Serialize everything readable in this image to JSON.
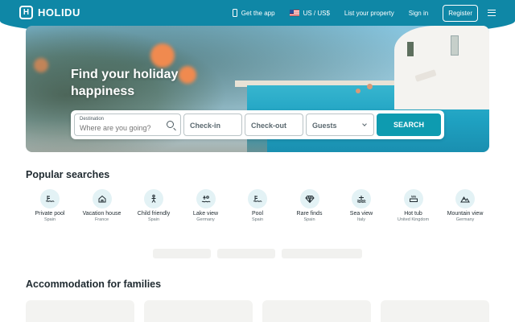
{
  "header": {
    "brand": "HOLIDU",
    "logo_letter": "H",
    "nav": {
      "get_app": "Get the app",
      "currency": "US / US$",
      "list_property": "List your property",
      "sign_in": "Sign in",
      "register": "Register"
    },
    "accent_color": "#0f87a6"
  },
  "hero": {
    "title": "Find your holiday happiness",
    "search": {
      "destination_label": "Destination",
      "destination_placeholder": "Where are you going?",
      "checkin": "Check-in",
      "checkout": "Check-out",
      "guests": "Guests",
      "button": "SEARCH"
    }
  },
  "popular": {
    "title": "Popular searches",
    "items": [
      {
        "label": "Private pool",
        "sub": "Spain",
        "icon": "pool-icon"
      },
      {
        "label": "Vacation house",
        "sub": "France",
        "icon": "house-icon"
      },
      {
        "label": "Child friendly",
        "sub": "Spain",
        "icon": "child-icon"
      },
      {
        "label": "Lake view",
        "sub": "Germany",
        "icon": "lake-icon"
      },
      {
        "label": "Pool",
        "sub": "Spain",
        "icon": "pool-icon"
      },
      {
        "label": "Rare finds",
        "sub": "Spain",
        "icon": "diamond-icon"
      },
      {
        "label": "Sea view",
        "sub": "Italy",
        "icon": "sea-icon"
      },
      {
        "label": "Hot tub",
        "sub": "United Kingdom",
        "icon": "hot-tub-icon"
      },
      {
        "label": "Mountain view",
        "sub": "Germany",
        "icon": "mountain-icon"
      }
    ]
  },
  "families": {
    "title": "Accommodation for families"
  }
}
